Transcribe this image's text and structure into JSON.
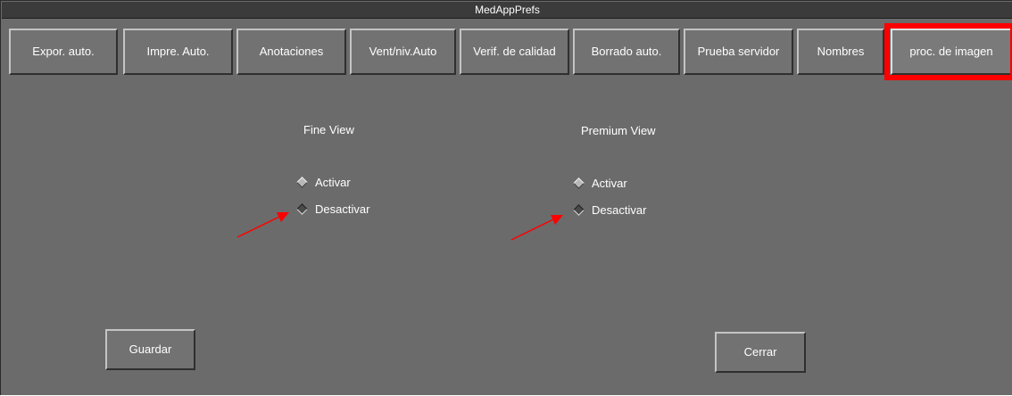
{
  "window": {
    "title": "MedAppPrefs"
  },
  "tabs": [
    {
      "label": "Expor. auto."
    },
    {
      "label": "Impre. Auto."
    },
    {
      "label": "Anotaciones"
    },
    {
      "label": "Vent/niv.Auto"
    },
    {
      "label": "Verif. de calidad"
    },
    {
      "label": "Borrado auto."
    },
    {
      "label": "Prueba servidor"
    },
    {
      "label": "Nombres"
    },
    {
      "label": "proc. de imagen",
      "active": true
    }
  ],
  "fine_view": {
    "title": "Fine View",
    "options": [
      {
        "label": "Activar"
      },
      {
        "label": "Desactivar"
      }
    ],
    "selected": "Desactivar"
  },
  "premium_view": {
    "title": "Premium View",
    "options": [
      {
        "label": "Activar"
      },
      {
        "label": "Desactivar"
      }
    ],
    "selected": "Desactivar"
  },
  "buttons": {
    "save": "Guardar",
    "close": "Cerrar"
  },
  "colors": {
    "highlight": "#ff0000",
    "arrow": "#ff0000",
    "background": "#6b6b6b"
  }
}
